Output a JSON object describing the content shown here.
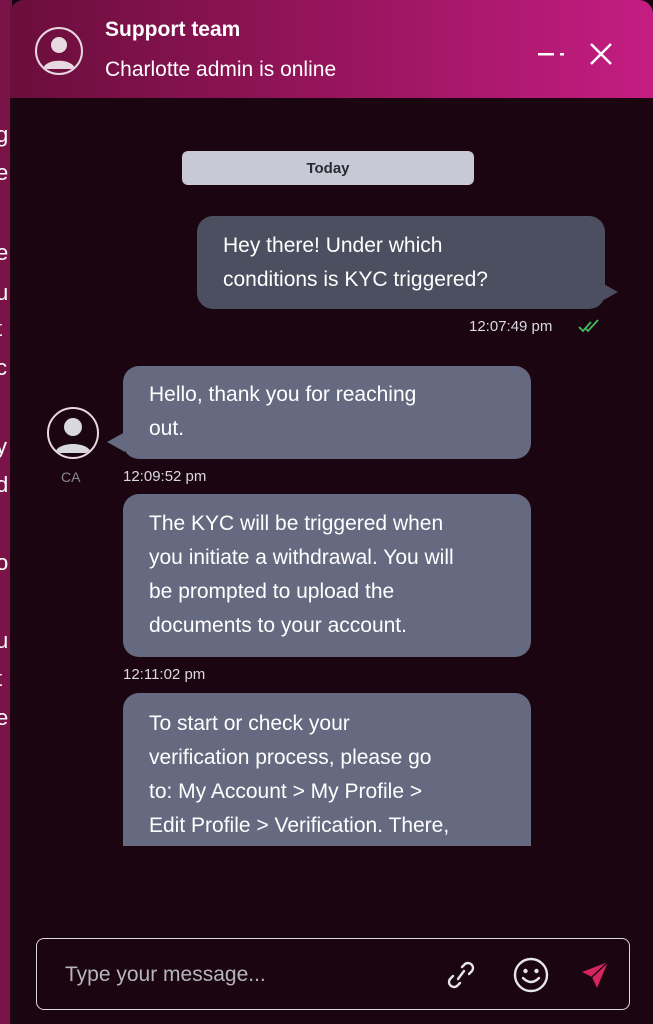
{
  "background": {
    "letters": [
      "g",
      "e",
      "e",
      "u",
      "t",
      "c",
      "y",
      "d",
      "o",
      "u",
      "t",
      "e"
    ]
  },
  "header": {
    "title": "Support team",
    "subtitle": "Charlotte admin is online",
    "minimize_icon": "minimize-icon",
    "close_icon": "close-icon",
    "gradient_colors": [
      "#6a0e3b",
      "#c41d82"
    ]
  },
  "chat": {
    "day_label": "Today",
    "messages": [
      {
        "direction": "outgoing",
        "text": "Hey there! Under which\nconditions is KYC triggered?",
        "time": "12:07:49 pm",
        "status_icon": "double-check-icon"
      },
      {
        "direction": "incoming",
        "text": "Hello, thank you for reaching\nout.",
        "time": "12:09:52 pm",
        "sender_initials": "CA"
      },
      {
        "direction": "incoming",
        "text": "The KYC will be triggered when\nyou initiate a withdrawal. You will\nbe prompted to upload the\ndocuments to your account.",
        "time": "12:11:02 pm"
      },
      {
        "direction": "incoming",
        "text": "To start or check your\nverification process, please go\nto: My Account > My Profile >\nEdit Profile > Verification. There,"
      }
    ]
  },
  "composer": {
    "placeholder": "Type your message...",
    "value": "",
    "attach_icon": "link-icon",
    "emoji_icon": "smiley-icon",
    "send_icon": "send-icon",
    "send_color": "#d6245f"
  },
  "colors": {
    "outgoing_bubble": "#4b4f5f",
    "incoming_bubble": "#666a80",
    "check": "#3fbf5f"
  }
}
